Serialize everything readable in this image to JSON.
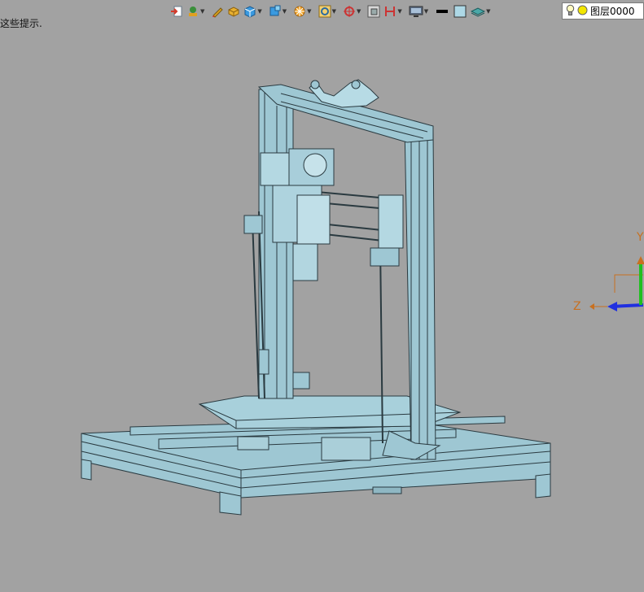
{
  "hint_text": "这些提示.",
  "toolbar": {
    "buttons": [
      {
        "name": "exit-sketch-icon",
        "color": "#d43a2a"
      },
      {
        "name": "move-object-icon",
        "color": "#3a8f3a"
      },
      {
        "name": "pencil-icon",
        "color": "#d9a020"
      },
      {
        "name": "solid-block-icon",
        "color": "#e0a020"
      },
      {
        "name": "cube-icon",
        "color": "#2a8fd8"
      },
      {
        "name": "cube-display-icon",
        "color": "#2a8fd8"
      },
      {
        "name": "render-mode-icon",
        "color": "#e0a020"
      },
      {
        "name": "zoom-fit-icon",
        "color": "#d9a020"
      },
      {
        "name": "view-orient-icon",
        "color": "#cc3333"
      },
      {
        "name": "section-view-icon",
        "color": "#666666"
      },
      {
        "name": "dimension-icon",
        "color": "#cc3333"
      },
      {
        "name": "display-monitor-icon",
        "color": "#555555"
      },
      {
        "name": "line-color-icon",
        "color": "#000000"
      },
      {
        "name": "face-color-icon",
        "color": "#add8e6"
      },
      {
        "name": "layer-stack-icon",
        "color": "#4aa8a8"
      }
    ]
  },
  "layer": {
    "name": "图层0000",
    "bulb_icon": "lightbulb-icon",
    "status_icon": "yellow-circle-icon"
  },
  "axes": {
    "y_label": "Y",
    "z_label": "Z",
    "colors": {
      "x": "#e03030",
      "y": "#20c020",
      "z": "#2030e0",
      "label": "#c87020"
    }
  },
  "model": {
    "name": "3d-printer-frame",
    "fill_color": "#9ec7d3",
    "edge_color": "#2a3a40"
  }
}
